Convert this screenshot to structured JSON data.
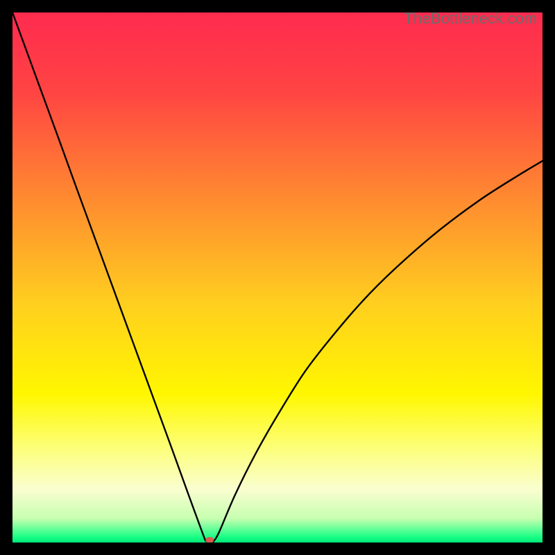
{
  "watermark": "TheBottleneck.com",
  "chart_data": {
    "type": "line",
    "title": "",
    "xlabel": "",
    "ylabel": "",
    "xlim": [
      0,
      100
    ],
    "ylim": [
      0,
      100
    ],
    "grid": false,
    "legend": false,
    "background_gradient_stops": [
      {
        "offset": 0.0,
        "color": "#ff2b4f"
      },
      {
        "offset": 0.15,
        "color": "#ff4443"
      },
      {
        "offset": 0.35,
        "color": "#ff8a30"
      },
      {
        "offset": 0.55,
        "color": "#ffcf1f"
      },
      {
        "offset": 0.72,
        "color": "#fff700"
      },
      {
        "offset": 0.82,
        "color": "#fdff77"
      },
      {
        "offset": 0.9,
        "color": "#fafed0"
      },
      {
        "offset": 0.955,
        "color": "#c6ffb0"
      },
      {
        "offset": 0.99,
        "color": "#17ff85"
      },
      {
        "offset": 1.0,
        "color": "#00e676"
      }
    ],
    "series": [
      {
        "name": "bottleneck-curve",
        "color": "#000000",
        "x": [
          0.0,
          3.0,
          6.0,
          9.0,
          12.0,
          15.0,
          18.0,
          21.0,
          24.0,
          27.0,
          30.0,
          33.0,
          36.0,
          36.5,
          37.0,
          37.3,
          37.6,
          38.0,
          39.0,
          42.0,
          46.0,
          50.0,
          55.0,
          60.0,
          66.0,
          72.0,
          80.0,
          88.0,
          95.0,
          100.0
        ],
        "y": [
          100.0,
          91.8,
          83.6,
          75.4,
          67.1,
          58.9,
          50.7,
          42.5,
          34.3,
          26.1,
          17.9,
          9.6,
          1.4,
          0.3,
          0.0,
          0.0,
          0.0,
          0.3,
          2.0,
          9.0,
          17.0,
          24.0,
          32.0,
          38.5,
          45.5,
          51.5,
          58.5,
          64.5,
          69.0,
          72.0
        ]
      }
    ],
    "marker": {
      "name": "optimum-point",
      "x": 37.2,
      "y": 0.2,
      "color": "#d85b4c",
      "rx": 6,
      "ry": 4.5
    }
  }
}
